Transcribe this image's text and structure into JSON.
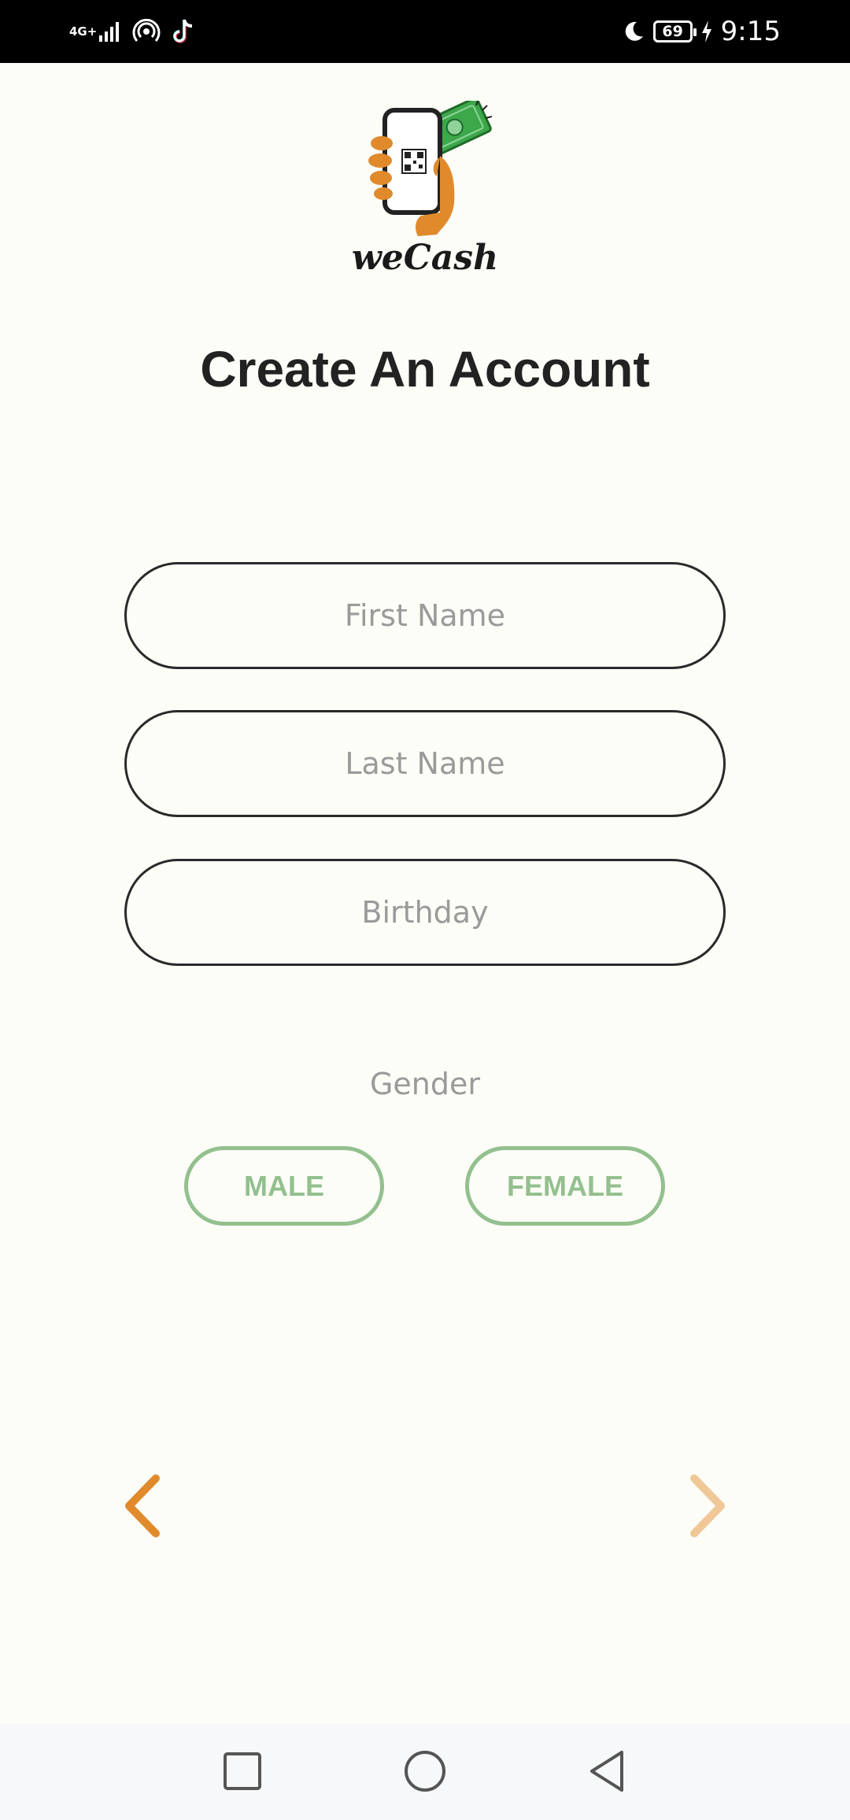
{
  "status_bar": {
    "network": "4G+",
    "battery": "69",
    "time": "9:15"
  },
  "brand": {
    "name": "weCash",
    "accent_color": "#E08A2C",
    "money_color": "#3CA84A"
  },
  "page": {
    "title": "Create An Account"
  },
  "form": {
    "first_name_placeholder": "First Name",
    "last_name_placeholder": "Last Name",
    "birthday_placeholder": "Birthday",
    "gender_label": "Gender",
    "gender_options": [
      "MALE",
      "FEMALE"
    ],
    "gender_color": "#93C08E"
  },
  "navigation": {
    "back_icon": "chevron-left-icon",
    "next_icon": "chevron-right-icon",
    "back_color": "#E08A2C",
    "next_color": "#F0C898"
  },
  "system_nav": {
    "recent_icon": "square-icon",
    "home_icon": "circle-icon",
    "back_icon": "triangle-back-icon"
  }
}
